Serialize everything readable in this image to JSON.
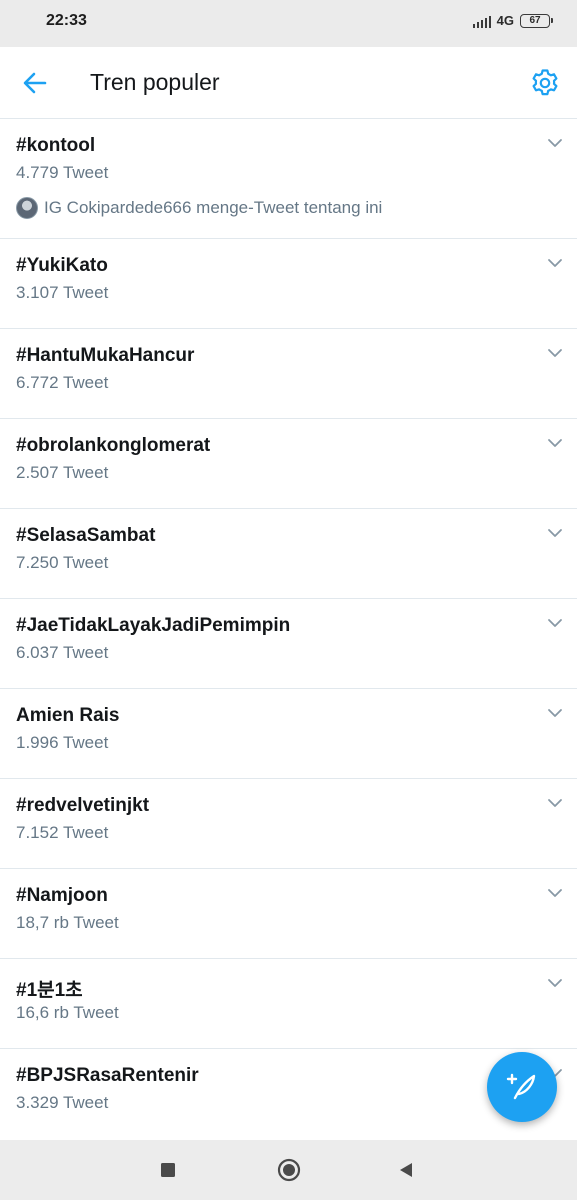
{
  "status_bar": {
    "time": "22:33",
    "network": "4G",
    "battery": "67"
  },
  "header": {
    "title": "Tren populer",
    "back_icon": "arrow-left-icon",
    "settings_icon": "gear-icon",
    "accent_color": "#1da1f2"
  },
  "trends": [
    {
      "name": "#kontool",
      "count": "4.779 Tweet",
      "context": "IG Cokipardede666 menge-Tweet tentang ini"
    },
    {
      "name": "#YukiKato",
      "count": "3.107 Tweet"
    },
    {
      "name": "#HantuMukaHancur",
      "count": "6.772 Tweet"
    },
    {
      "name": "#obrolankonglomerat",
      "count": "2.507 Tweet"
    },
    {
      "name": "#SelasaSambat",
      "count": "7.250 Tweet"
    },
    {
      "name": "#JaeTidakLayakJadiPemimpin",
      "count": "6.037 Tweet"
    },
    {
      "name": "Amien Rais",
      "count": "1.996 Tweet"
    },
    {
      "name": "#redvelvetinjkt",
      "count": "7.152 Tweet"
    },
    {
      "name": "#Namjoon",
      "count": "18,7 rb Tweet"
    },
    {
      "name": "#1분1초",
      "count": "16,6 rb Tweet"
    },
    {
      "name": "#BPJSRasaRentenir",
      "count": "3.329 Tweet"
    }
  ],
  "fab": {
    "icon": "compose-tweet-icon"
  },
  "nav": {
    "recents_icon": "square-icon",
    "home_icon": "circle-icon",
    "back_icon": "triangle-back-icon"
  }
}
